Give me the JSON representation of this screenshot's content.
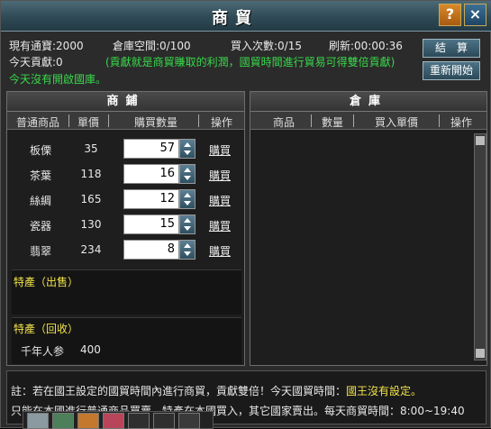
{
  "window": {
    "title": "商貿",
    "help_label": "?",
    "close_label": "×"
  },
  "info": {
    "currency": "現有通寶:2000",
    "storage": "倉庫空間:0/100",
    "buy_count": "買入次數:0/15",
    "refresh": "刷新:00:00:36",
    "contribution": "今天貢獻:0",
    "hint": "(貢獻就是商貿賺取的利潤，國貿時間進行貿易可得雙倍貢獻)",
    "status": "今天沒有開啟國庫。"
  },
  "buttons": {
    "settle": "結　算",
    "restart": "重新開始"
  },
  "shop": {
    "title": "商鋪",
    "columns": [
      "普通商品",
      "單價",
      "購買數量",
      "操作"
    ],
    "items": [
      {
        "name": "板傈",
        "price": "35",
        "qty": "57",
        "action": "購買"
      },
      {
        "name": "茶葉",
        "price": "118",
        "qty": "16",
        "action": "購買"
      },
      {
        "name": "絲綢",
        "price": "165",
        "qty": "12",
        "action": "購買"
      },
      {
        "name": "瓷器",
        "price": "130",
        "qty": "15",
        "action": "購買"
      },
      {
        "name": "翡翠",
        "price": "234",
        "qty": "8",
        "action": "購買"
      }
    ],
    "special_sell_label": "特產（出售）",
    "special_buy_label": "特產（回收）",
    "special_buy_item": {
      "name": "千年人参",
      "price": "400"
    }
  },
  "warehouse": {
    "title": "倉庫",
    "columns": [
      "商品",
      "數量",
      "買入單價",
      "操作"
    ]
  },
  "notes": {
    "line1_prefix": "註：若在國王設定的國貿時間內進行商貿，貢獻雙倍！今天國貿時間：",
    "line1_highlight": "國王沒有設定。",
    "line2": "只能在本國進行普通商品買賣，特產在本國買入，其它國家賣出。每天商貿時間：8:00~19:40"
  },
  "colors": {
    "green_text": "#38d84a",
    "yellow_text": "#f2e34a",
    "title_bar": "#2f4a56"
  }
}
